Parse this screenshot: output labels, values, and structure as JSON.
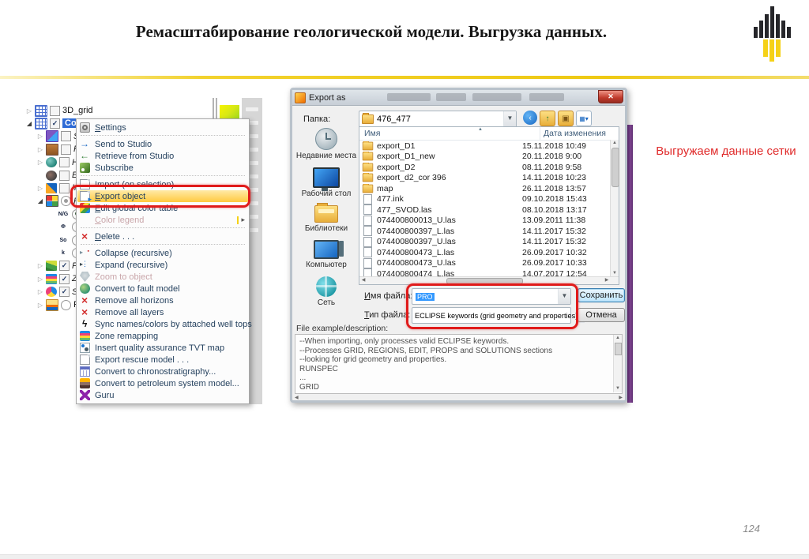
{
  "slide": {
    "title": "Ремасштабирование геологической модели. Выгрузка данных.",
    "page_number": "124",
    "annotation": "Выгружаем данные сетки",
    "accent_yellow": "#f2d22e",
    "annotation_color": "#e02b2b",
    "logo": "rosneft-logo"
  },
  "tree": {
    "rows": [
      {
        "label": "3D_grid",
        "expander": "collapsed",
        "toggle": "checkbox",
        "checked": false,
        "icon": "grid3d",
        "indent": 0,
        "italic": false,
        "selected": false
      },
      {
        "label": "Copy",
        "expander": "expanded",
        "toggle": "checkbox",
        "checked": true,
        "icon": "grid3d",
        "indent": 0,
        "italic": false,
        "selected": true
      },
      {
        "label": "Sk",
        "expander": "collapsed",
        "toggle": "checkbox",
        "checked": false,
        "icon": "skeleton",
        "indent": 1,
        "italic": true,
        "selected": false
      },
      {
        "label": "Fa",
        "expander": "collapsed",
        "toggle": "checkbox",
        "checked": false,
        "icon": "faults",
        "indent": 1,
        "italic": true,
        "selected": false
      },
      {
        "label": "Ho",
        "expander": "collapsed",
        "toggle": "checkbox",
        "checked": false,
        "icon": "horizons",
        "indent": 1,
        "italic": true,
        "selected": false
      },
      {
        "label": "Ed",
        "expander": "none",
        "toggle": "checkbox",
        "checked": false,
        "icon": "edges",
        "indent": 1,
        "italic": true,
        "selected": false
      },
      {
        "label": "Inte",
        "expander": "collapsed",
        "toggle": "checkbox",
        "checked": false,
        "icon": "intersections",
        "indent": 1,
        "italic": true,
        "selected": false
      },
      {
        "label": "Pr",
        "expander": "expanded",
        "toggle": "radio-gray",
        "checked": true,
        "icon": "properties",
        "indent": 1,
        "italic": true,
        "selected": false
      },
      {
        "label": "",
        "glyph": "N/G",
        "expander": "none",
        "toggle": "radio",
        "checked": true,
        "icon": "glyph",
        "indent": 2,
        "italic": false,
        "selected": false
      },
      {
        "label": "",
        "glyph": "Φ",
        "expander": "none",
        "toggle": "radio",
        "checked": false,
        "icon": "glyph",
        "indent": 2,
        "italic": false,
        "selected": false
      },
      {
        "label": "",
        "glyph": "So",
        "expander": "none",
        "toggle": "radio",
        "checked": false,
        "icon": "glyph",
        "indent": 2,
        "italic": false,
        "selected": false
      },
      {
        "label": "",
        "glyph": "k",
        "expander": "none",
        "toggle": "radio",
        "checked": false,
        "icon": "glyph",
        "indent": 2,
        "italic": false,
        "selected": false
      },
      {
        "label": "Fa",
        "expander": "collapsed",
        "toggle": "checkbox",
        "checked": true,
        "icon": "mountains",
        "indent": 1,
        "italic": true,
        "selected": false
      },
      {
        "label": "Zo",
        "expander": "collapsed",
        "toggle": "checkbox",
        "checked": true,
        "icon": "zones",
        "indent": 1,
        "italic": true,
        "selected": false
      },
      {
        "label": "Se",
        "expander": "collapsed",
        "toggle": "checkbox",
        "checked": true,
        "icon": "segments",
        "indent": 1,
        "italic": true,
        "selected": false
      },
      {
        "label": "Flu",
        "expander": "collapsed",
        "toggle": "radio",
        "checked": false,
        "icon": "fluid",
        "indent": 1,
        "italic": false,
        "selected": false
      }
    ]
  },
  "context_menu": {
    "items": [
      {
        "label": "Settings",
        "icon": "settings",
        "mnemonic": 0
      },
      {
        "separator": true
      },
      {
        "label": "Send to Studio",
        "icon": "send"
      },
      {
        "label": "Retrieve from Studio",
        "icon": "retrieve"
      },
      {
        "label": "Subscribe",
        "icon": "subscribe"
      },
      {
        "separator": true
      },
      {
        "label": "Import (on selection)",
        "icon": "import"
      },
      {
        "label": "Export object",
        "icon": "export",
        "highlighted": true,
        "mnemonic": 0
      },
      {
        "label": "Edit global color table",
        "icon": "colortable",
        "mnemonic": 0
      },
      {
        "label": "Color legend",
        "icon": "none",
        "disabled": true,
        "submenu": true,
        "mnemonic": 0
      },
      {
        "separator": true
      },
      {
        "label": "Delete . . .",
        "icon": "delete",
        "mnemonic": 0
      },
      {
        "separator": true
      },
      {
        "label": "Collapse (recursive)",
        "icon": "collapse"
      },
      {
        "label": "Expand (recursive)",
        "icon": "expand"
      },
      {
        "label": "Zoom to object",
        "icon": "zoom",
        "disabled": true
      },
      {
        "label": "Convert to fault model",
        "icon": "faultmodel"
      },
      {
        "label": "Remove all horizons",
        "icon": "removex"
      },
      {
        "label": "Remove all layers",
        "icon": "removex"
      },
      {
        "label": "Sync names/colors by attached well tops",
        "icon": "bolt"
      },
      {
        "label": "Zone remapping",
        "icon": "zonemap"
      },
      {
        "label": "Insert quality assurance TVT map",
        "icon": "qamap"
      },
      {
        "label": "Export rescue model . . .",
        "icon": "rescue"
      },
      {
        "label": "Convert to chronostratigraphy...",
        "icon": "chrono"
      },
      {
        "label": "Convert to petroleum system model...",
        "icon": "petroleum"
      },
      {
        "label": "Guru",
        "icon": "guru"
      }
    ]
  },
  "dialog": {
    "title": "Export as",
    "close_glyph": "✕",
    "folder_label": "Папка:",
    "folder_value": "476_477",
    "toolbar_icons": [
      "back",
      "up-folder",
      "new-folder",
      "views"
    ],
    "sidebar": [
      {
        "label": "Недавние места",
        "icon": "recent-places"
      },
      {
        "label": "Рабочий стол",
        "icon": "desktop"
      },
      {
        "label": "Библиотеки",
        "icon": "libraries"
      },
      {
        "label": "Компьютер",
        "icon": "computer"
      },
      {
        "label": "Сеть",
        "icon": "network"
      }
    ],
    "columns": {
      "name": "Имя",
      "date": "Дата изменения"
    },
    "files": [
      {
        "name": "export_D1",
        "date": "15.11.2018 10:49",
        "kind": "folder"
      },
      {
        "name": "export_D1_new",
        "date": "20.11.2018 9:00",
        "kind": "folder"
      },
      {
        "name": "export_D2",
        "date": "08.11.2018 9:58",
        "kind": "folder"
      },
      {
        "name": "export_d2_cor 396",
        "date": "14.11.2018 10:23",
        "kind": "folder"
      },
      {
        "name": "map",
        "date": "26.11.2018 13:57",
        "kind": "folder"
      },
      {
        "name": "477.ink",
        "date": "09.10.2018 15:43",
        "kind": "file"
      },
      {
        "name": "477_SVOD.las",
        "date": "08.10.2018 13:17",
        "kind": "file"
      },
      {
        "name": "074400800013_U.las",
        "date": "13.09.2011 11:38",
        "kind": "file"
      },
      {
        "name": "074400800397_L.las",
        "date": "14.11.2017 15:32",
        "kind": "file"
      },
      {
        "name": "074400800397_U.las",
        "date": "14.11.2017 15:32",
        "kind": "file"
      },
      {
        "name": "074400800473_L.las",
        "date": "26.09.2017 10:32",
        "kind": "file"
      },
      {
        "name": "074400800473_U.las",
        "date": "26.09.2017 10:33",
        "kind": "file"
      },
      {
        "name": "074400800474_L.las",
        "date": "14.07.2017 12:54",
        "kind": "file"
      }
    ],
    "filename_label": "Имя файла:",
    "filename_value": "PRO",
    "filetype_label": "Тип файла:",
    "filetype_value": "ECLIPSE keywords (grid geometry and properties)",
    "save_label": "Сохранить",
    "cancel_label": "Отмена",
    "description_label": "File example/description:",
    "description_lines": [
      "--When importing, only processes valid ECLIPSE keywords.",
      "--Processes GRID, REGIONS, EDIT, PROPS and SOLUTIONS  sections",
      "--looking for grid geometry and properties.",
      "RUNSPEC",
      "...",
      "GRID"
    ]
  }
}
